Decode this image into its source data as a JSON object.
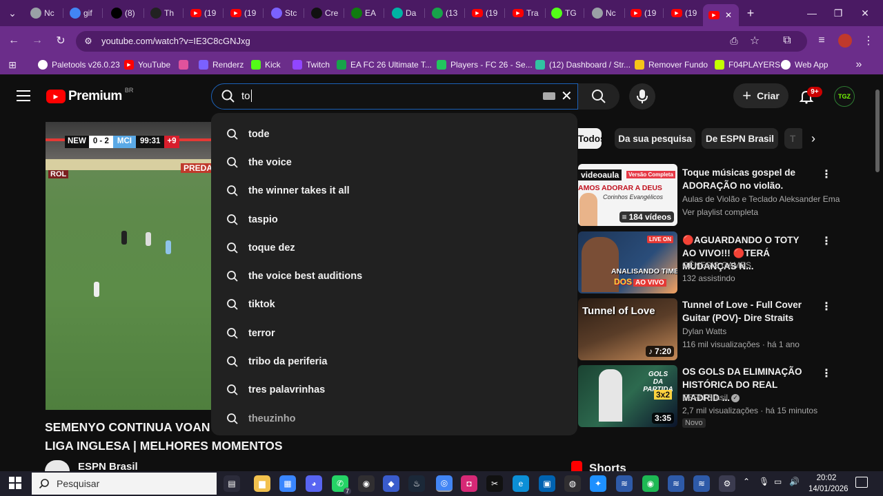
{
  "browser": {
    "tabs": [
      {
        "label": "Nc",
        "icon": "chrome-icon",
        "color": "#9aa0a6"
      },
      {
        "label": "gif",
        "icon": "google-icon",
        "color": "#4285f4"
      },
      {
        "label": "(8)",
        "icon": "x-icon",
        "color": "#000000"
      },
      {
        "label": "Th",
        "icon": "threads-icon",
        "color": "#222222"
      },
      {
        "label": "(19",
        "icon": "youtube-icon",
        "color": "#ff0000"
      },
      {
        "label": "(19",
        "icon": "youtube-icon",
        "color": "#ff0000"
      },
      {
        "label": "Stc",
        "icon": "renderz-icon",
        "color": "#7b61ff"
      },
      {
        "label": "Cre",
        "icon": "creator-icon",
        "color": "#111111"
      },
      {
        "label": "EA",
        "icon": "xbox-icon",
        "color": "#107c10"
      },
      {
        "label": "Da",
        "icon": "dashboard-icon",
        "color": "#00b3a4"
      },
      {
        "label": "(13",
        "icon": "futbin-icon",
        "color": "#17a34a"
      },
      {
        "label": "(19",
        "icon": "youtube-icon",
        "color": "#ff0000"
      },
      {
        "label": "Tra",
        "icon": "youtube-icon",
        "color": "#ff0000"
      },
      {
        "label": "TG",
        "icon": "kick-icon",
        "color": "#53fc18"
      },
      {
        "label": "Nc",
        "icon": "chrome-icon",
        "color": "#9aa0a6"
      },
      {
        "label": "(19",
        "icon": "youtube-icon",
        "color": "#ff0000"
      },
      {
        "label": "(19",
        "icon": "youtube-icon",
        "color": "#ff0000"
      }
    ],
    "active_tab_close": "✕",
    "new_tab": "+",
    "url": "youtube.com/watch?v=IE3C8cGNJxg",
    "bookmarks": [
      {
        "label": "Paletools v26.0.23",
        "icon": "paletools-icon",
        "color": "#ffffff"
      },
      {
        "label": "YouTube",
        "icon": "youtube-icon",
        "color": "#ff0000"
      },
      {
        "label": "",
        "icon": "pinwheel-icon",
        "color": "#e0529c"
      },
      {
        "label": "Renderz",
        "icon": "renderz-icon",
        "color": "#7b61ff"
      },
      {
        "label": "Kick",
        "icon": "kick-icon",
        "color": "#53fc18"
      },
      {
        "label": "Twitch",
        "icon": "twitch-icon",
        "color": "#9146ff"
      },
      {
        "label": "EA FC 26 Ultimate T...",
        "icon": "futbin-icon",
        "color": "#17a34a"
      },
      {
        "label": "Players - FC 26 - Se...",
        "icon": "futgg-icon",
        "color": "#22c55e"
      },
      {
        "label": "(12) Dashboard / Str...",
        "icon": "streamlabs-icon",
        "color": "#31c3a2"
      },
      {
        "label": "Remover Fundo",
        "icon": "remover-icon",
        "color": "#f5c518"
      },
      {
        "label": "F04PLAYERS",
        "icon": "fo4-icon",
        "color": "#c4ff00"
      },
      {
        "label": "Web App",
        "icon": "ea-web-icon",
        "color": "#ffffff"
      }
    ]
  },
  "youtube": {
    "logo_text": "Premium",
    "logo_region": "BR",
    "search_value": "to",
    "suggestions": [
      "tode",
      "the voice",
      "the winner takes it all",
      "taspio",
      "toque dez",
      "the voice best auditions",
      "tiktok",
      "terror",
      "tribo da periferia",
      "tres palavrinhas",
      "theuzinho"
    ],
    "create_label": "Criar",
    "notif_badge": "9+",
    "avatar_text": "TGZ",
    "chips": [
      "Todos",
      "Da sua pesquisa",
      "De ESPN Brasil",
      "T"
    ],
    "player": {
      "score_home": "NEW",
      "score": "0 - 2",
      "score_away": "MCI",
      "clock": "99:31",
      "added": "+9",
      "board_text": "PREDA",
      "board_text2": "ROL"
    },
    "video_title_line1": "SEMENYO CONTINUA VOAN",
    "video_title_line2": "LIGA INGLESA | MELHORES MOMENTOS",
    "channel_name": "ESPN Brasil",
    "shorts_label": "Shorts",
    "related": [
      {
        "title": "Toque músicas gospel de ADORAÇÃO no violão.",
        "meta1": "Aulas de Violão e Teclado Aleksander Ema",
        "meta2": "Ver playlist completa",
        "badge": "184 vídeos",
        "thumb_top": "videoaula",
        "thumb_top2": "Versão Completa",
        "thumb_mid": "AMOS ADORAR A DEUS",
        "thumb_sub": "Corinhos Evangélicos",
        "thumb_colors": [
          "#f7f7f7",
          "#e63946"
        ]
      },
      {
        "title": "🔴AGUARDANDO O TOTY AO VIVO!!! 🔴TERÁ MUDANÇAS N...",
        "meta1": "GÊNESIS GAMES",
        "meta2": "132 assistindo",
        "badge": "",
        "thumb_top": "LIVE ON",
        "thumb_mid": "ANALISANDO TIMES",
        "thumb_sub": "DOS",
        "thumb_live": "AO VIVO",
        "thumb_colors": [
          "#1d3557",
          "#f4a261"
        ]
      },
      {
        "title": "Tunnel of Love - Full Cover Guitar (POV)- Dire Straits",
        "meta1": "Dylan Watts",
        "meta2": "116 mil visualizações · há 1 ano",
        "badge": "7:20",
        "thumb_top": "Tunnel of Love",
        "thumb_colors": [
          "#3b2a1e",
          "#c68b59"
        ]
      },
      {
        "title": "OS GOLS DA ELIMINAÇÃO HISTÓRICA DO REAL MADRID ...",
        "meta1": "ESPN Brasil",
        "meta2": "2,7 mil visualizações · há 15 minutos",
        "meta3": "Novo",
        "badge": "3:35",
        "thumb_top": "GOLS DA PARTIDA",
        "thumb_score": "3x2",
        "thumb_colors": [
          "#2d6a4f",
          "#0b132b"
        ]
      }
    ]
  },
  "taskbar": {
    "search_placeholder": "Pesquisar",
    "whatsapp_badge": "7",
    "time": "20:02",
    "date": "14/01/2026"
  }
}
